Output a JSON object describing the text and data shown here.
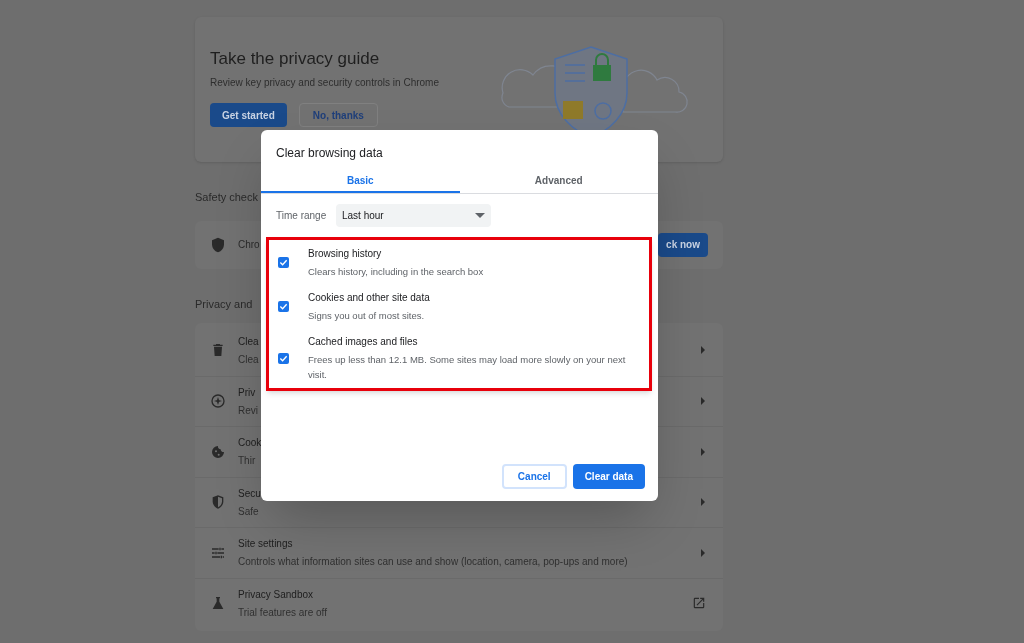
{
  "privacy_guide": {
    "title": "Take the privacy guide",
    "description": "Review key privacy and security controls in Chrome",
    "buttons": [
      {
        "label": "Get started",
        "kind": "primary"
      },
      {
        "label": "No, thanks",
        "kind": "secondary"
      }
    ]
  },
  "safety_check": {
    "heading": "Safety check",
    "text": "Chro",
    "button": "ck now"
  },
  "privacy_section": {
    "heading": "Privacy and",
    "rows": [
      {
        "kind": "trash",
        "title": "Clea",
        "subtitle": "Clea",
        "external_link": false
      },
      {
        "kind": "compass",
        "title": "Priv",
        "subtitle": "Revi",
        "external_link": false
      },
      {
        "kind": "cookie",
        "title": "Cook",
        "subtitle": "Thir",
        "external_link": false
      },
      {
        "kind": "shield",
        "title": "Secu",
        "subtitle": "Safe",
        "external_link": false
      },
      {
        "kind": "sliders",
        "title": "Site settings",
        "subtitle": "Controls what information sites can use and show (location, camera, pop-ups and more)",
        "external_link": false
      },
      {
        "kind": "flask",
        "title": "Privacy Sandbox",
        "subtitle": "Trial features are off",
        "external_link": true
      }
    ]
  },
  "dialog": {
    "title": "Clear browsing data",
    "tabs": [
      {
        "label": "Basic",
        "selected": true
      },
      {
        "label": "Advanced",
        "selected": false
      }
    ],
    "time_range": {
      "label": "Time range",
      "value": "Last hour"
    },
    "items": [
      {
        "title": "Browsing history",
        "description": "Clears history, including in the search box",
        "checked": true
      },
      {
        "title": "Cookies and other site data",
        "description": "Signs you out of most sites.",
        "checked": true
      },
      {
        "title": "Cached images and files",
        "description": "Frees up less than 12.1 MB. Some sites may load more slowly on your next visit.",
        "checked": true
      }
    ],
    "buttons": [
      {
        "label": "Cancel",
        "kind": "secondary"
      },
      {
        "label": "Clear data",
        "kind": "primary"
      }
    ]
  }
}
